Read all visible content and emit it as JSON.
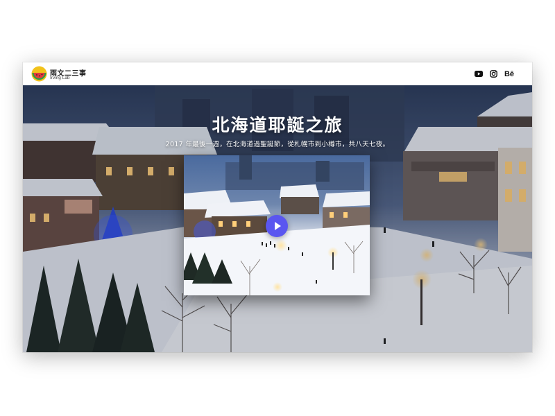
{
  "header": {
    "logo_title": "雨文二三事",
    "logo_subtitle": "Irving Lab",
    "social": [
      {
        "icon": "youtube-icon"
      },
      {
        "icon": "instagram-icon"
      },
      {
        "icon": "behance-icon",
        "text": "Bē"
      }
    ]
  },
  "hero": {
    "title": "北海道耶誕之旅",
    "subtitle": "2017 年最後一週，在北海道過聖誕節，從札幌市到小樽市，共八天七夜。",
    "video": {
      "play_icon": "play-icon"
    }
  },
  "colors": {
    "play_button": "#5a56f0",
    "night_sky": "#3a4a66",
    "snow": "#e9edf6"
  }
}
